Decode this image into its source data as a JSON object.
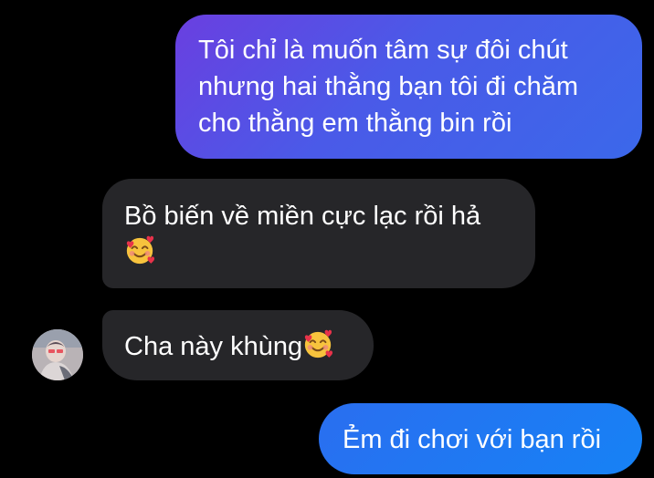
{
  "messages": [
    {
      "direction": "outgoing",
      "lines": [
        "Tôi chỉ là muốn tâm sự đôi chút",
        "nhưng hai thằng bạn tôi đi chăm",
        "cho thằng em thằng bin rồi"
      ]
    },
    {
      "direction": "incoming",
      "lines": [
        "Bồ biến về miền cực lạc rồi hả"
      ],
      "emoji": "smiling-face-with-hearts"
    },
    {
      "direction": "incoming",
      "text": "Cha này khùng",
      "emoji": "smiling-face-with-hearts"
    },
    {
      "direction": "outgoing",
      "text": "Ẻm đi chơi với bạn rồi"
    }
  ],
  "colors": {
    "background": "#000000",
    "incoming_bubble": "#262629",
    "outgoing_gradient_start": "#6a3fe0",
    "outgoing_gradient_end": "#1682f5",
    "text": "#ffffff"
  },
  "avatar": {
    "icon": "user-avatar-photo"
  }
}
